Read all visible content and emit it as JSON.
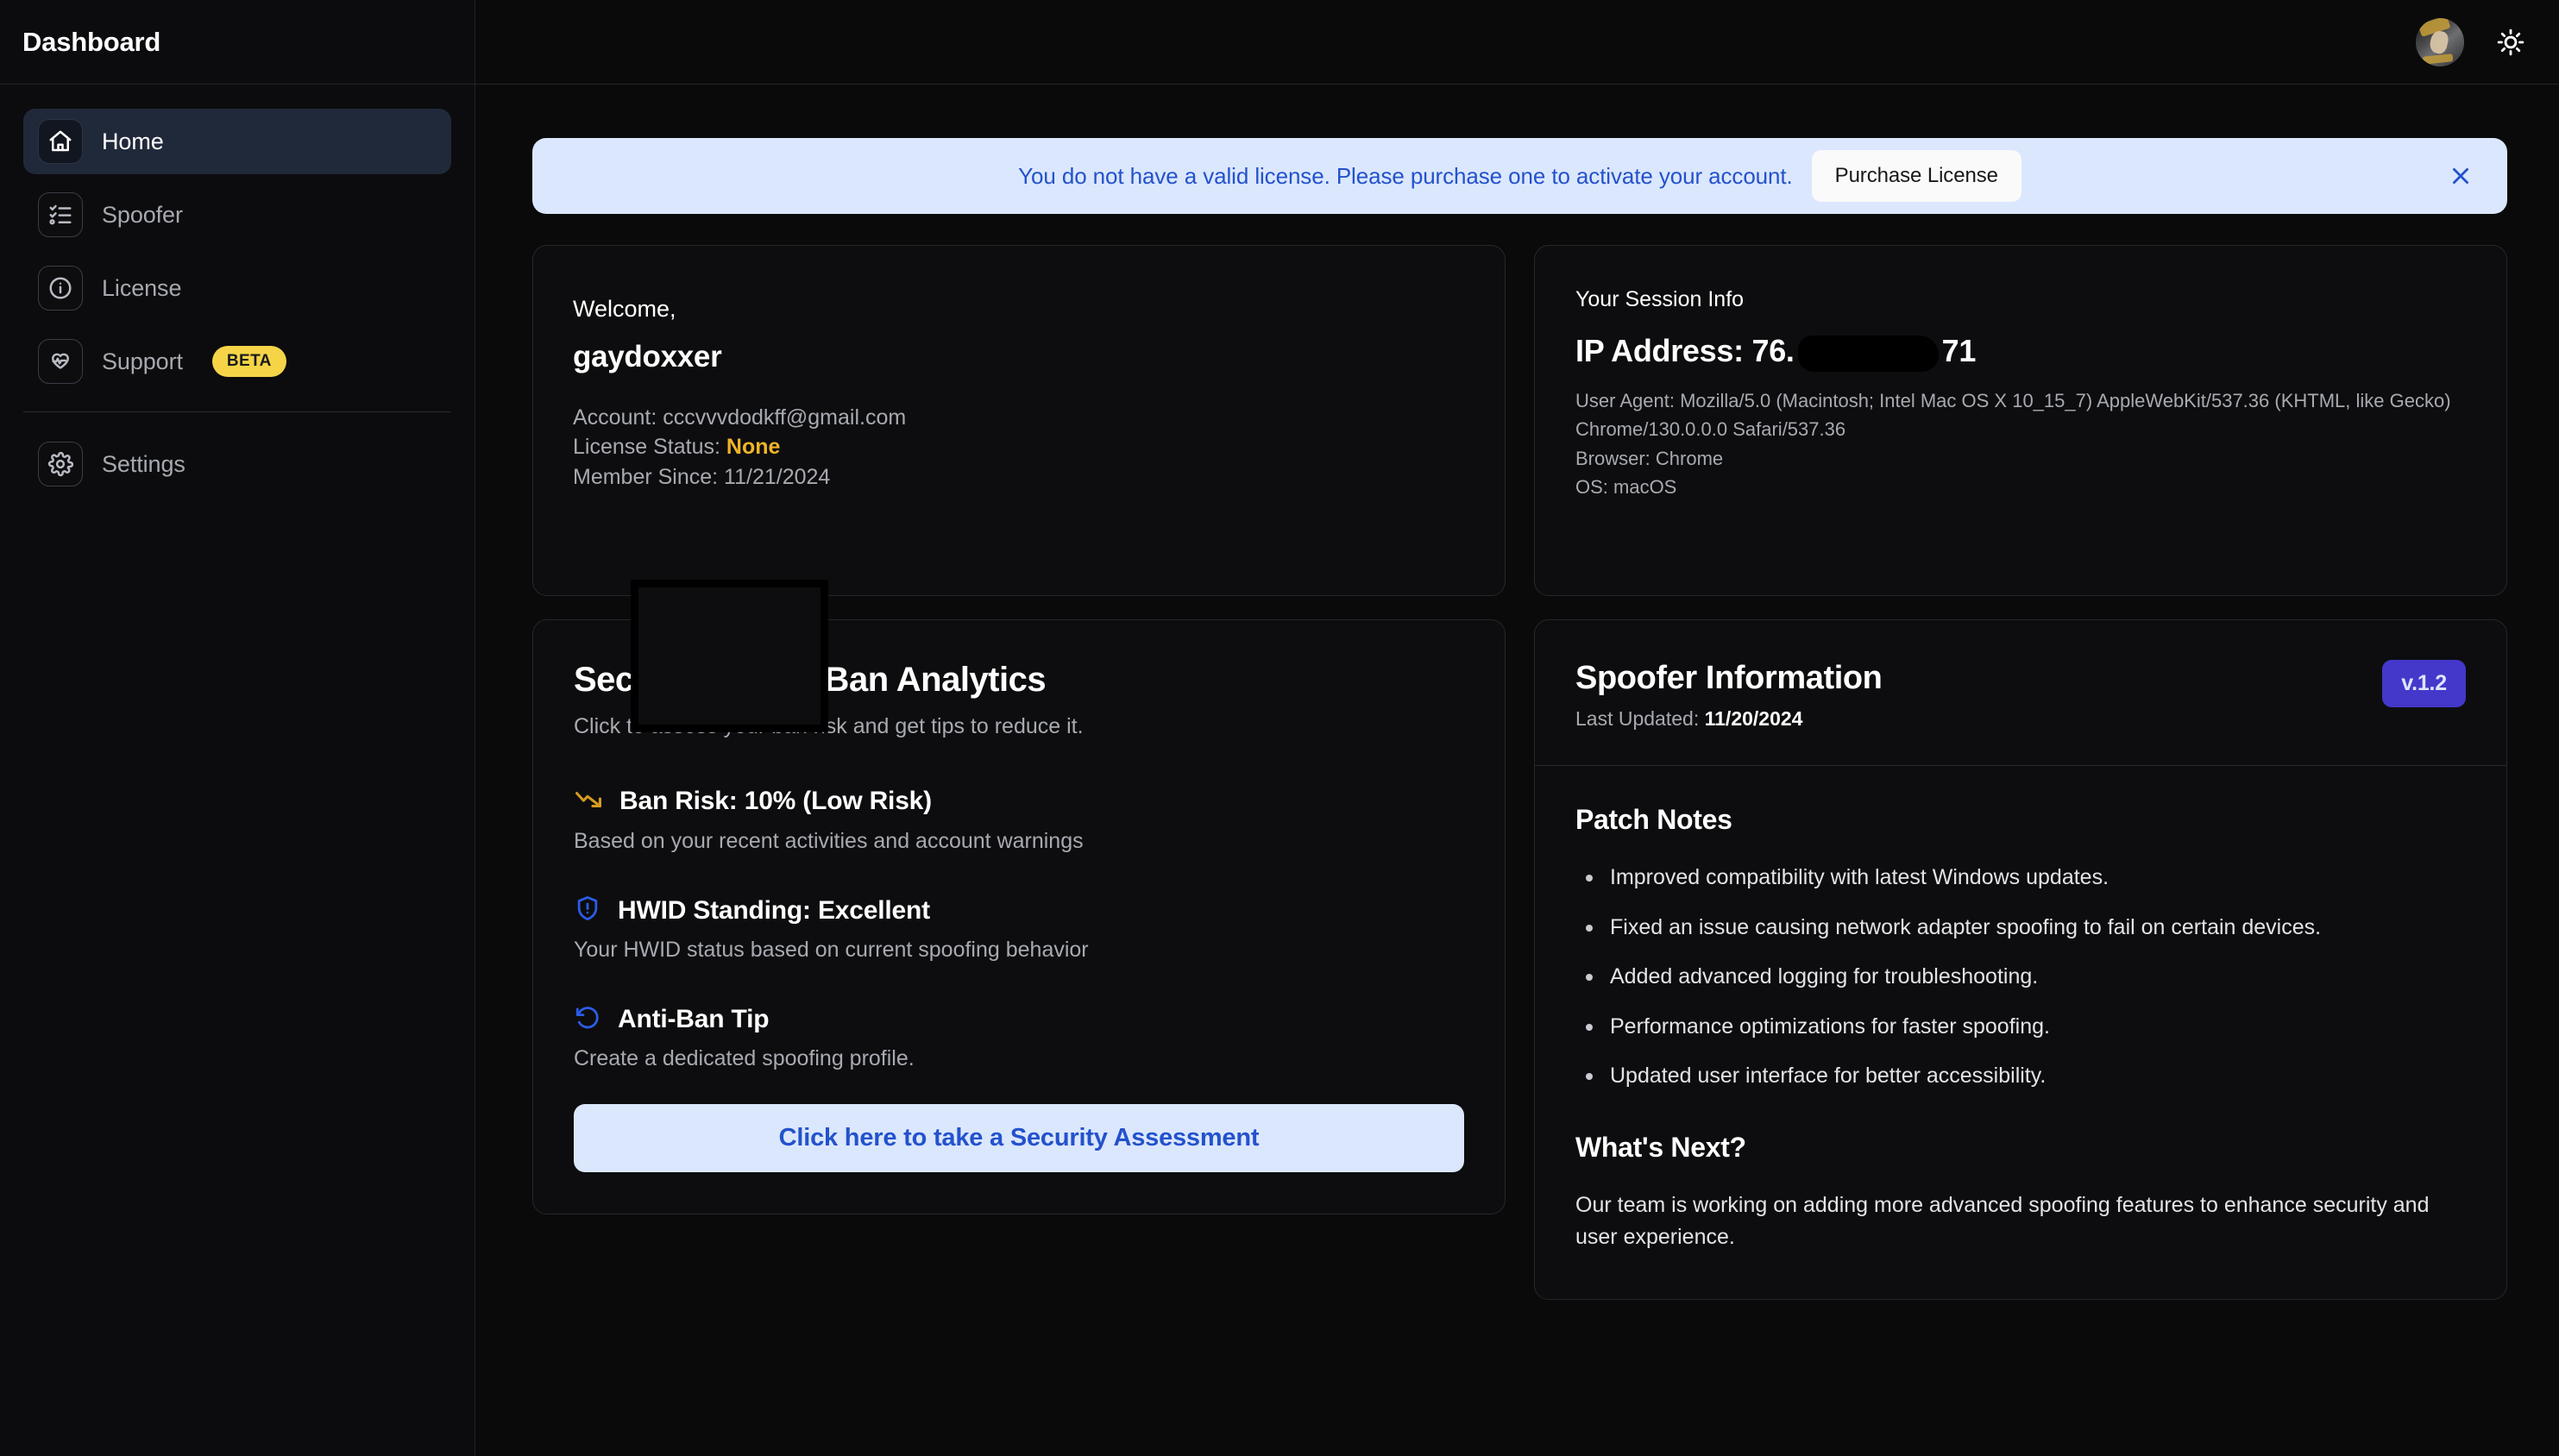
{
  "sidebar": {
    "title": "Dashboard",
    "items": [
      {
        "label": "Home",
        "icon": "home-icon",
        "active": true,
        "badge": null
      },
      {
        "label": "Spoofer",
        "icon": "checklist-icon",
        "active": false,
        "badge": null
      },
      {
        "label": "License",
        "icon": "info-circle-icon",
        "active": false,
        "badge": null
      },
      {
        "label": "Support",
        "icon": "heart-pulse-icon",
        "active": false,
        "badge": "BETA"
      },
      {
        "label": "Settings",
        "icon": "gear-icon",
        "active": false,
        "badge": null
      }
    ]
  },
  "topbar": {
    "avatar": "user-avatar",
    "theme_toggle_icon": "sun-icon"
  },
  "banner": {
    "message": "You do not have a valid license. Please purchase one to activate your account.",
    "button_label": "Purchase License",
    "close_icon": "close-icon",
    "bg_color": "#dbe7fd",
    "text_color": "#2352cc"
  },
  "welcome": {
    "greeting": "Welcome,",
    "username": "gaydoxxer",
    "account_label": "Account: cccvvvdodkff@gmail.com",
    "license_status_label": "License Status: ",
    "license_status_value": "None",
    "license_status_color": "#f0b429",
    "member_since": "Member Since: 11/21/2024"
  },
  "session": {
    "title": "Your Session Info",
    "ip_prefix": "IP Address: 76.",
    "ip_suffix": "71",
    "user_agent": "User Agent: Mozilla/5.0 (Macintosh; Intel Mac OS X 10_15_7) AppleWebKit/537.36 (KHTML, like Gecko) Chrome/130.0.0.0 Safari/537.36",
    "browser": "Browser: Chrome",
    "os": "OS: macOS"
  },
  "security": {
    "title": "Security & Anti-Ban Analytics",
    "subtitle": "Click to assess your ban risk and get tips to reduce it.",
    "ban_risk_title": "Ban Risk: 10% (Low Risk)",
    "ban_risk_icon": "trending-down-icon",
    "ban_risk_icon_color": "#d49b20",
    "ban_risk_desc": "Based on your recent activities and account warnings",
    "hwid_title": "HWID Standing: Excellent",
    "hwid_icon": "shield-alert-icon",
    "hwid_icon_color": "#2b5ce6",
    "hwid_desc": "Your HWID status based on current spoofing behavior",
    "tip_title": "Anti-Ban Tip",
    "tip_icon": "rotate-ccw-icon",
    "tip_icon_color": "#2b5ce6",
    "tip_desc": "Create a dedicated spoofing profile.",
    "assessment_button": "Click here to take a Security Assessment"
  },
  "spoofer": {
    "title": "Spoofer Information",
    "last_updated_label": "Last Updated: ",
    "last_updated_value": "11/20/2024",
    "version": "v.1.2",
    "version_color": "#4338ca",
    "patch_notes_title": "Patch Notes",
    "patch_notes": [
      "Improved compatibility with latest Windows updates.",
      "Fixed an issue causing network adapter spoofing to fail on certain devices.",
      "Added advanced logging for troubleshooting.",
      "Performance optimizations for faster spoofing.",
      "Updated user interface for better accessibility."
    ],
    "next_title": "What's Next?",
    "next_body": "Our team is working on adding more advanced spoofing features to enhance security and user experience."
  }
}
